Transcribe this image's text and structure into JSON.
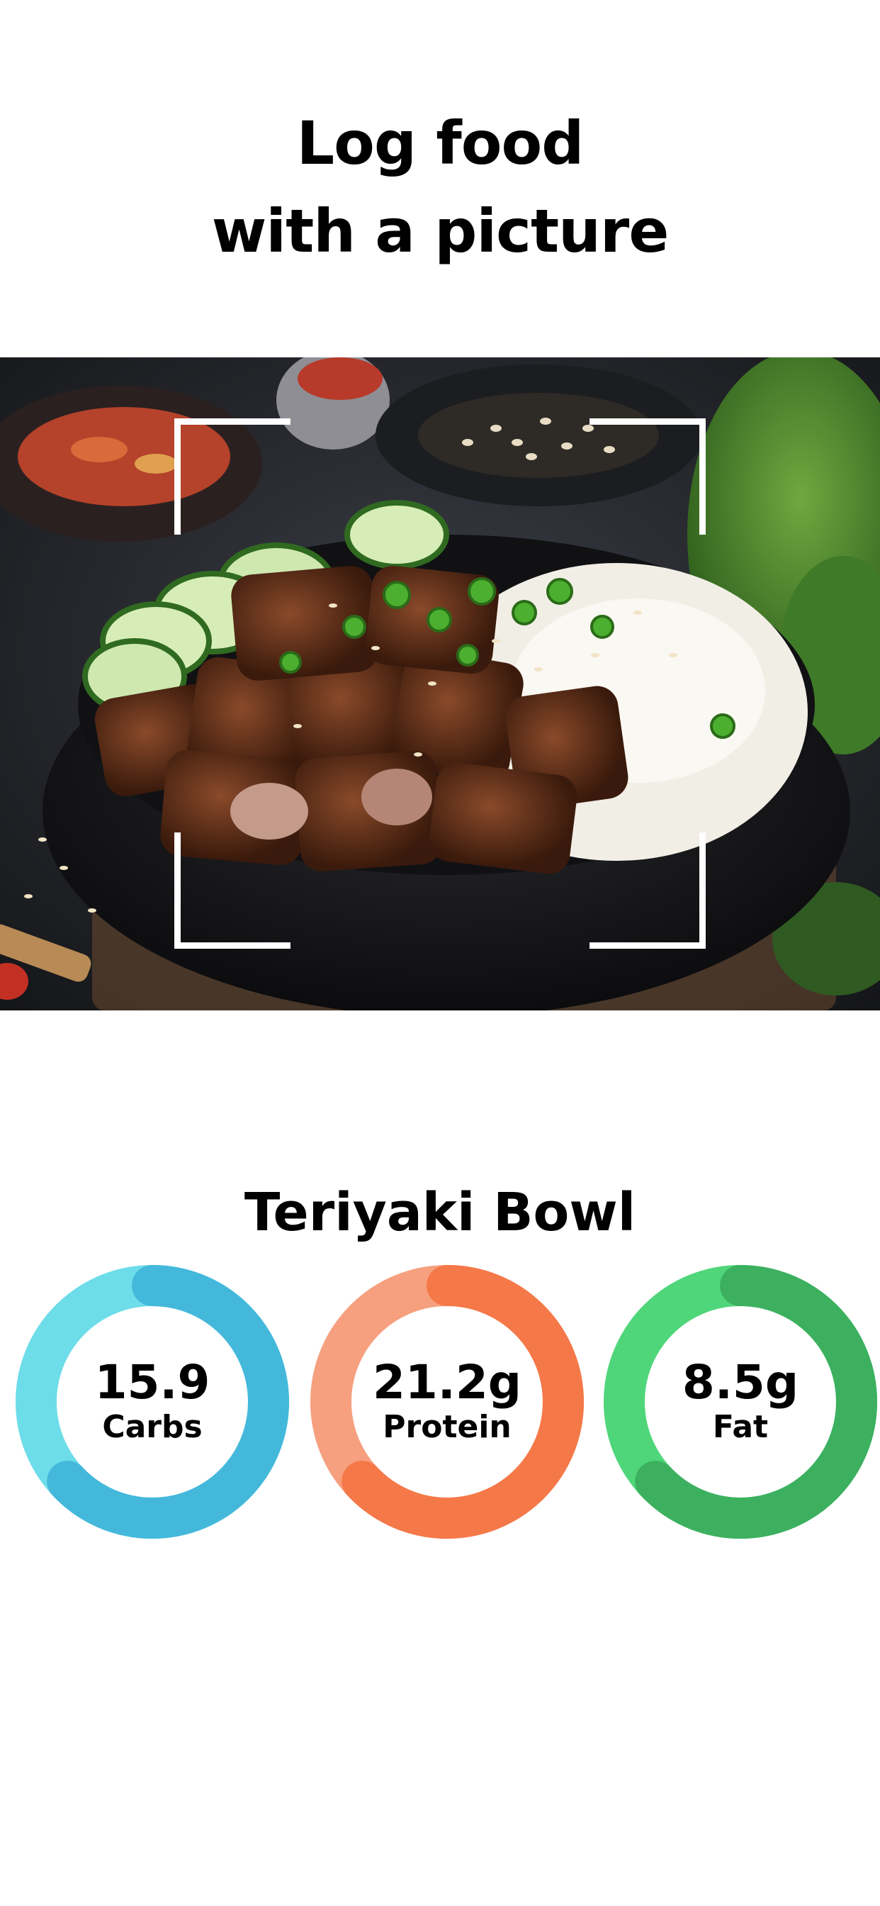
{
  "header": {
    "title_line1": "Log food",
    "title_line2": "with a picture"
  },
  "photo": {
    "subject": "teriyaki-bowl-photo",
    "overlay": "scan-frame-corners"
  },
  "food": {
    "name": "Teriyaki Bowl"
  },
  "macros": [
    {
      "value": "15.9",
      "label": "Carbs",
      "progress": 0.63,
      "light": "#6ddde9",
      "dark": "#43b8db"
    },
    {
      "value": "21.2g",
      "label": "Protein",
      "progress": 0.63,
      "light": "#f6a07f",
      "dark": "#f57848"
    },
    {
      "value": "8.5g",
      "label": "Fat",
      "progress": 0.63,
      "light": "#4fd67a",
      "dark": "#3cb05f"
    }
  ]
}
